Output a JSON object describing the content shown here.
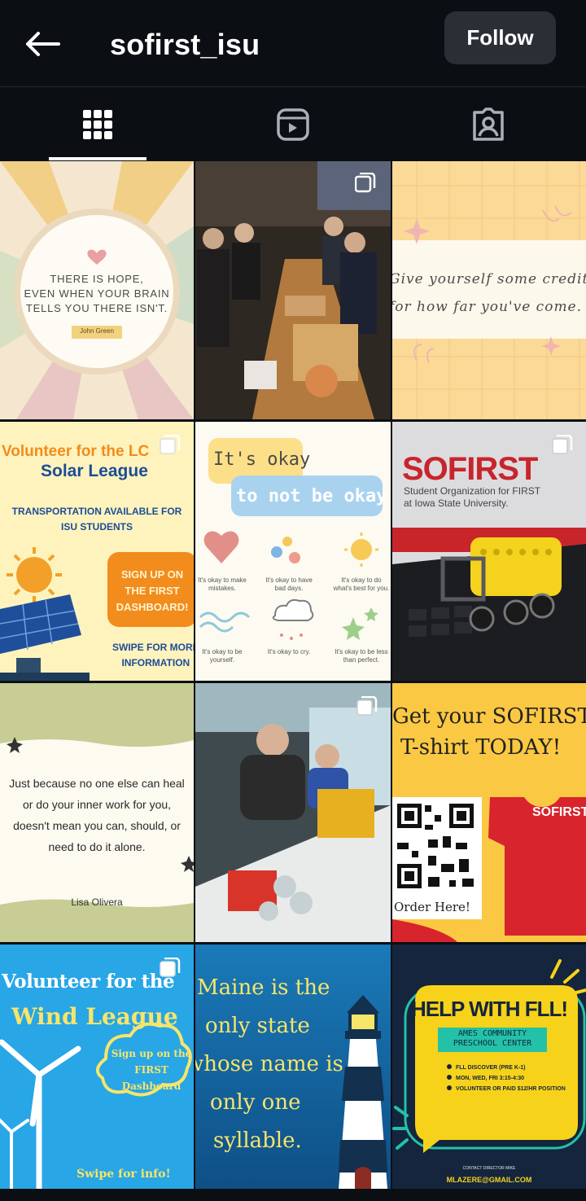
{
  "header": {
    "username": "sofirst_isu",
    "follow_label": "Follow"
  },
  "tabs": [
    {
      "name": "posts",
      "icon": "grid-icon",
      "active": true
    },
    {
      "name": "reels",
      "icon": "reels-icon"
    },
    {
      "name": "tagged",
      "icon": "tagged-icon"
    }
  ],
  "posts": {
    "p1": {
      "quote": [
        "THERE IS HOPE,",
        "EVEN WHEN YOUR BRAIN",
        "TELLS YOU THERE ISN'T."
      ],
      "author": "John Green"
    },
    "p3": {
      "lines": [
        "Give yourself some credit",
        "for how far you've come."
      ]
    },
    "p4": {
      "title1": "Volunteer for the ",
      "title1b": "LC",
      "title2": "Solar League",
      "transport": [
        "TRANSPORTATION AVAILABLE FOR",
        "ISU STUDENTS"
      ],
      "signup": [
        "SIGN UP ON",
        "THE FIRST",
        "DASHBOARD!"
      ],
      "swipe": [
        "SWIPE FOR MORE",
        "INFORMATION"
      ]
    },
    "p5": {
      "line1": "It's okay",
      "line2": "to not be okay.",
      "items": [
        "It's okay to make mistakes.",
        "It's okay to have bad days.",
        "It's okay to do what's best for you.",
        "It's okay to be yourself.",
        "It's okay to cry.",
        "It's okay to be less than perfect."
      ]
    },
    "p6": {
      "brand": "SOFIRST",
      "sub": [
        "Student Organization for FIRST",
        "at Iowa State University."
      ]
    },
    "p7": {
      "lines": [
        "Just because no one else can heal",
        "or do your inner work for you,",
        "doesn't mean you can, should, or",
        "need to do it alone."
      ],
      "author": "Lisa Olivera"
    },
    "p9": {
      "lines": [
        "Get your SOFIRST",
        "T-shirt TODAY!"
      ],
      "shirt": "SOFIRST",
      "order": "Order Here!"
    },
    "p10": {
      "title1": "Volunteer for the",
      "title2": "Wind League",
      "cloud": [
        "Sign up on the",
        "FIRST",
        "Dashboard"
      ],
      "swipe": "Swipe for info!"
    },
    "p11": {
      "lines": [
        "Maine is the",
        "only state",
        "whose name is",
        "only one",
        "syllable."
      ]
    },
    "p12": {
      "title": "HELP WITH FLL!",
      "org": [
        "AMES COMMUNITY",
        "PRESCHOOL CENTER"
      ],
      "bullets": [
        "FLL DISCOVER (PRE K-1)",
        "MON, WED, FRI 3:15-4:30",
        "VOLUNTEER OR PAID $12/HR POSITION"
      ],
      "contact": "CONTACT DIRECTOR MIKE",
      "email": "MLAZERE@GMAIL.COM"
    }
  },
  "colors": {
    "bg": "#0b0f14",
    "button": "#2a2f36"
  }
}
